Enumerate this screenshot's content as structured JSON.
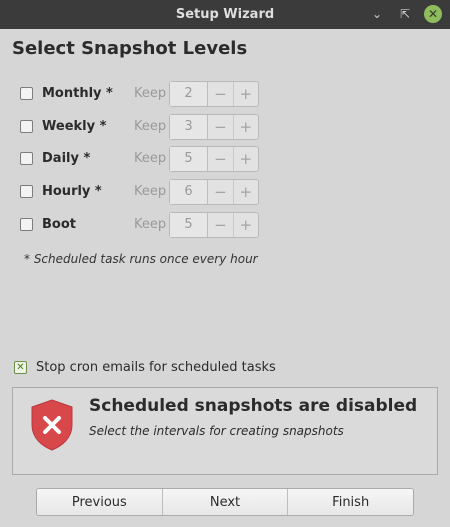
{
  "window": {
    "title": "Setup Wizard"
  },
  "page": {
    "heading": "Select Snapshot Levels"
  },
  "levels": [
    {
      "label": "Monthly *",
      "keep_label": "Keep",
      "value": "2",
      "checked": false
    },
    {
      "label": "Weekly *",
      "keep_label": "Keep",
      "value": "3",
      "checked": false
    },
    {
      "label": "Daily *",
      "keep_label": "Keep",
      "value": "5",
      "checked": false
    },
    {
      "label": "Hourly *",
      "keep_label": "Keep",
      "value": "6",
      "checked": false
    },
    {
      "label": "Boot",
      "keep_label": "Keep",
      "value": "5",
      "checked": false
    }
  ],
  "note": "* Scheduled task runs once every hour",
  "cron": {
    "label": "Stop cron emails for scheduled tasks",
    "checked": true
  },
  "status": {
    "title": "Scheduled snapshots are disabled",
    "subtitle": "Select the intervals for creating snapshots",
    "icon": "shield-x-icon"
  },
  "buttons": {
    "previous": "Previous",
    "next": "Next",
    "finish": "Finish"
  },
  "colors": {
    "titlebar": "#3b3b3b",
    "close": "#8fbd5d",
    "shield": "#d8474a",
    "background": "#d6d6d6"
  }
}
